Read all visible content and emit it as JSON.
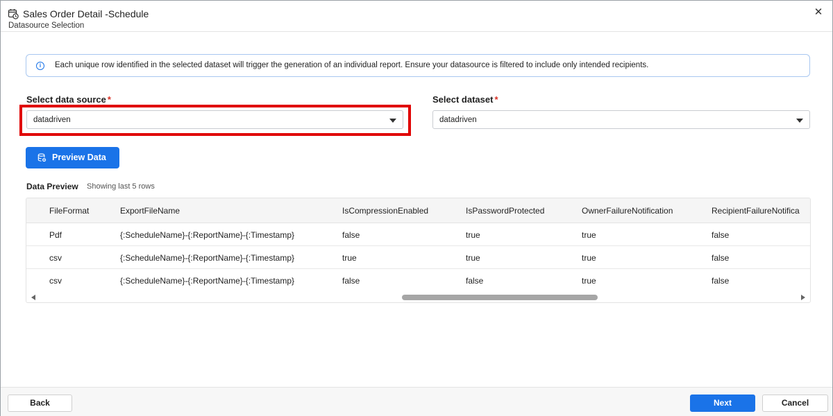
{
  "dialog": {
    "title": "Sales Order Detail -Schedule",
    "subtitle": "Datasource Selection",
    "close_glyph": "✕"
  },
  "info": {
    "icon": "i",
    "text": "Each unique row identified in the selected dataset will trigger the generation of an individual report. Ensure your datasource is filtered to include only intended recipients."
  },
  "datasource": {
    "label": "Select data source",
    "required_mark": "*",
    "value": "datadriven"
  },
  "dataset": {
    "label": "Select dataset",
    "required_mark": "*",
    "value": "datadriven"
  },
  "preview_button": {
    "label": "Preview Data"
  },
  "data_preview": {
    "title": "Data Preview",
    "subtitle": "Showing last 5 rows",
    "columns": [
      "FileFormat",
      "ExportFileName",
      "IsCompressionEnabled",
      "IsPasswordProtected",
      "OwnerFailureNotification",
      "RecipientFailureNotifica"
    ],
    "rows": [
      [
        "Pdf",
        "{:ScheduleName}-{:ReportName}-{:Timestamp}",
        "false",
        "true",
        "true",
        "false"
      ],
      [
        "csv",
        "{:ScheduleName}-{:ReportName}-{:Timestamp}",
        "true",
        "true",
        "true",
        "false"
      ],
      [
        "csv",
        "{:ScheduleName}-{:ReportName}-{:Timestamp}",
        "false",
        "false",
        "true",
        "false"
      ]
    ]
  },
  "footer": {
    "back_label": "Back",
    "next_label": "Next",
    "cancel_label": "Cancel"
  },
  "colors": {
    "accent": "#1a73e8",
    "highlight": "#e00000",
    "required": "#d93025"
  }
}
